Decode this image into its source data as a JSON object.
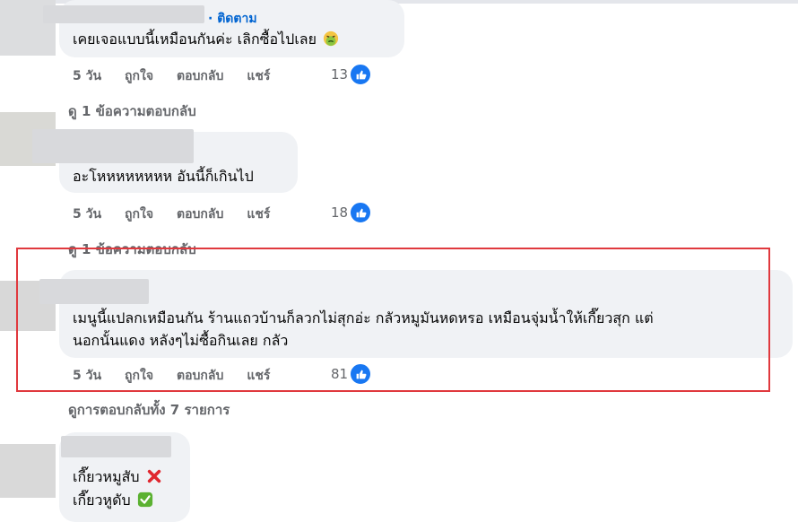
{
  "comments": [
    {
      "follow_label": "· ติดตาม",
      "text": "เคยเจอแบบนี้เหมือนกันค่ะ เลิกซื้อไปเลย",
      "age": "5 วัน",
      "like_label": "ถูกใจ",
      "reply_label": "ตอบกลับ",
      "share_label": "แชร์",
      "reaction_count": "13",
      "view_replies": "ดู 1 ข้อความตอบกลับ"
    },
    {
      "text": "อะโหหหหหหหห อันนี้ก็เกินไป",
      "age": "5 วัน",
      "like_label": "ถูกใจ",
      "reply_label": "ตอบกลับ",
      "share_label": "แชร์",
      "reaction_count": "18",
      "view_replies": "ดู 1 ข้อความตอบกลับ"
    },
    {
      "text_line1": "เมนูนี้แปลกเหมือนกัน ร้านแถวบ้านก็ลวกไม่สุกอ่ะ กลัวหมูมันหดหรอ เหมือนจุ่มน้ำให้เกี๊ยวสุก แต่",
      "text_line2": "นอกนั้นแดง หลังๆไม่ซื้อกินเลย กลัว",
      "age": "5 วัน",
      "like_label": "ถูกใจ",
      "reply_label": "ตอบกลับ",
      "share_label": "แชร์",
      "reaction_count": "81",
      "view_replies": "ดูการตอบกลับทั้ง 7 รายการ"
    },
    {
      "text_line1": "เกี๊ยวหมูสับ",
      "text_line2": "เกี๊ยวหูดับ"
    }
  ],
  "colors": {
    "highlight": "#e0393e",
    "link": "#0064d1",
    "like": "#1877f2"
  },
  "icons": {
    "reaction": "thumbs-up-icon",
    "emoji1": "nauseated-face-icon",
    "emoji2": "cross-mark-icon",
    "emoji3": "check-mark-button-icon"
  }
}
